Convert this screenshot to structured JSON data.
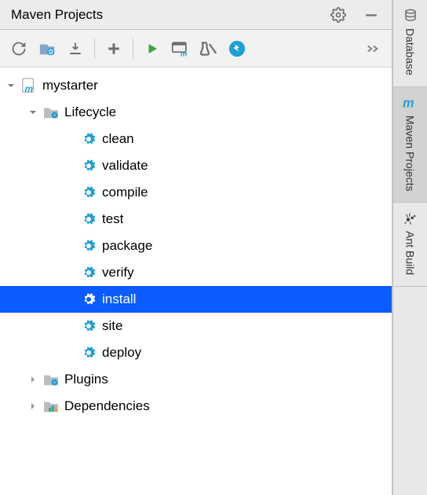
{
  "panel": {
    "title": "Maven Projects"
  },
  "rail": {
    "tabs": [
      {
        "label": "Database"
      },
      {
        "label": "Maven Projects"
      },
      {
        "label": "Ant Build"
      }
    ],
    "active_index": 1
  },
  "tree": {
    "project": "mystarter",
    "folders": {
      "lifecycle": "Lifecycle",
      "plugins": "Plugins",
      "dependencies": "Dependencies"
    },
    "lifecycle_goals": [
      "clean",
      "validate",
      "compile",
      "test",
      "package",
      "verify",
      "install",
      "site",
      "deploy"
    ],
    "selected_goal": "install"
  }
}
